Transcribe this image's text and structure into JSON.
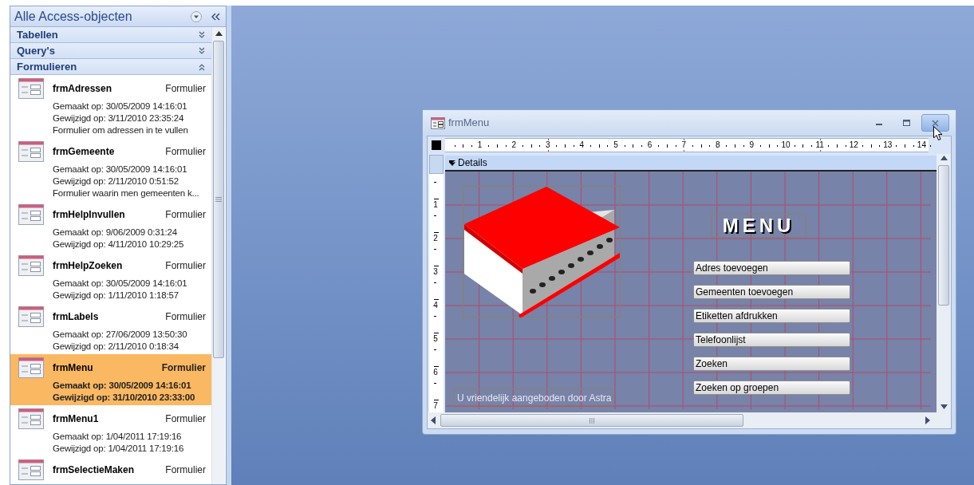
{
  "nav_pane": {
    "title": "Alle Access-objecten",
    "groups": [
      {
        "label": "Tabellen",
        "expanded": false
      },
      {
        "label": "Query's",
        "expanded": false
      },
      {
        "label": "Formulieren",
        "expanded": true,
        "items": [
          {
            "name": "frmAdressen",
            "type": "Formulier",
            "selected": false,
            "details": [
              "Gemaakt op: 30/05/2009 14:16:01",
              "Gewijzigd op: 3/11/2010 23:35:24",
              "Formulier om adressen in te vullen"
            ]
          },
          {
            "name": "frmGemeente",
            "type": "Formulier",
            "selected": false,
            "details": [
              "Gemaakt op: 30/05/2009 14:16:01",
              "Gewijzigd op: 2/11/2010 0:51:52",
              "Formulier waarin men gemeenten k..."
            ]
          },
          {
            "name": "frmHelpInvullen",
            "type": "Formulier",
            "selected": false,
            "details": [
              "Gemaakt op: 9/06/2009 0:31:24",
              "Gewijzigd op: 4/11/2010 10:29:25"
            ]
          },
          {
            "name": "frmHelpZoeken",
            "type": "Formulier",
            "selected": false,
            "details": [
              "Gemaakt op: 30/05/2009 14:16:01",
              "Gewijzigd op: 1/11/2010 1:18:57"
            ]
          },
          {
            "name": "frmLabels",
            "type": "Formulier",
            "selected": false,
            "details": [
              "Gemaakt op: 27/06/2009 13:50:30",
              "Gewijzigd op: 2/11/2010 0:18:34"
            ]
          },
          {
            "name": "frmMenu",
            "type": "Formulier",
            "selected": true,
            "details": [
              "Gemaakt op: 30/05/2009 14:16:01",
              "Gewijzigd op: 31/10/2010 23:33:00"
            ]
          },
          {
            "name": "frmMenu1",
            "type": "Formulier",
            "selected": false,
            "details": [
              "Gemaakt op: 1/04/2011 17:19:16",
              "Gewijzigd op: 1/04/2011 17:19:16"
            ]
          },
          {
            "name": "frmSelectieMaken",
            "type": "Formulier",
            "selected": false
          }
        ]
      }
    ]
  },
  "form_window": {
    "title": "frmMenu",
    "ruler": {
      "horizontal": [
        "1",
        "2",
        "3",
        "4",
        "5",
        "6",
        "7",
        "8",
        "9",
        "10",
        "11",
        "12",
        "13",
        "14"
      ],
      "vertical": [
        "1",
        "2",
        "3",
        "4",
        "5",
        "6",
        "7"
      ]
    },
    "section": "Details",
    "controls": [
      {
        "kind": "title",
        "text": "MENU"
      },
      {
        "kind": "button",
        "text": "Adres toevoegen"
      },
      {
        "kind": "button",
        "text": "Gemeenten toevoegen"
      },
      {
        "kind": "button",
        "text": "Etiketten afdrukken"
      },
      {
        "kind": "button",
        "text": "Telefoonlijst"
      },
      {
        "kind": "button",
        "text": "Zoeken"
      },
      {
        "kind": "button",
        "text": "Zoeken op groepen"
      },
      {
        "kind": "label",
        "text": "U vriendelijk aangeboden door Astra"
      }
    ]
  }
}
